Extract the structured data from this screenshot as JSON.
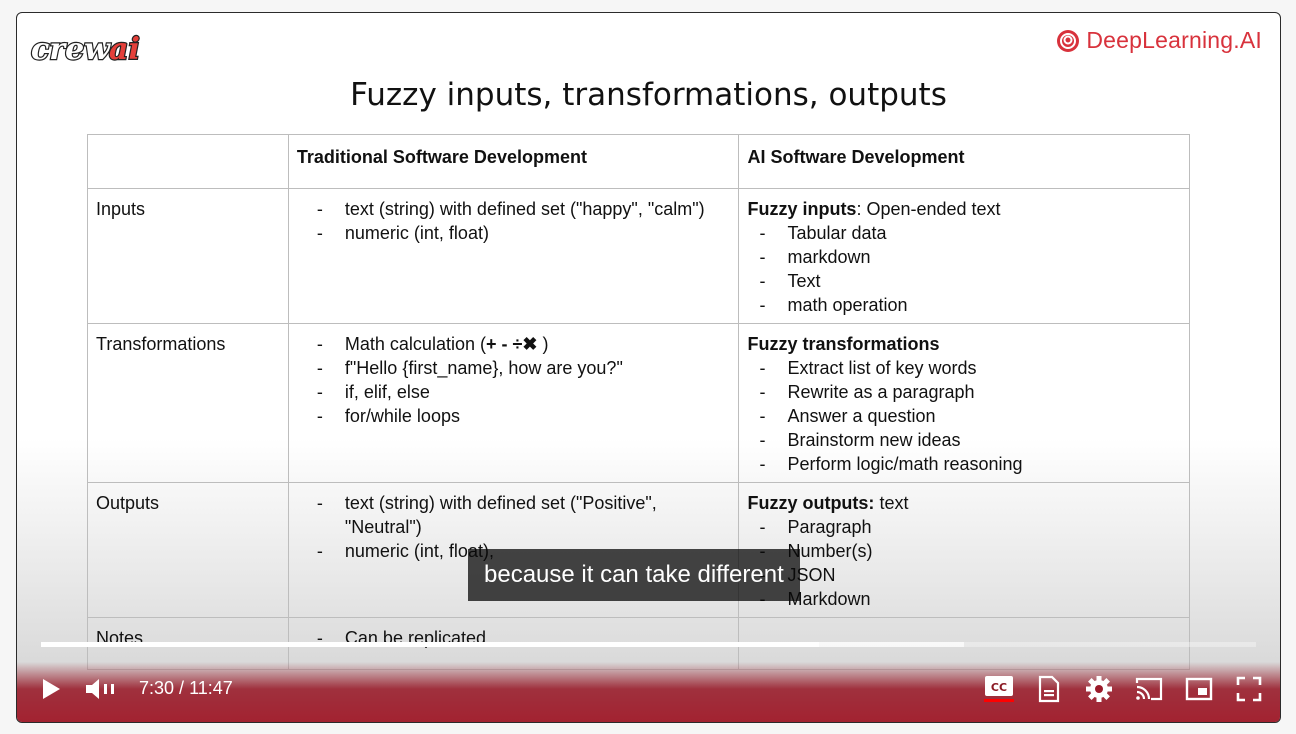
{
  "logos": {
    "left": "crewai",
    "right": "DeepLearning.AI"
  },
  "slide": {
    "title": "Fuzzy inputs, transformations, outputs",
    "headers": [
      "",
      "Traditional Software Development",
      "AI Software Development"
    ],
    "rows": [
      {
        "label": "Inputs",
        "traditional": [
          "text (string) with defined set (\"happy\", \"calm\")",
          "numeric (int, float)"
        ],
        "ai_title": "Fuzzy inputs",
        "ai_title_suffix": ": Open-ended text",
        "ai": [
          "Tabular data",
          "markdown",
          "Text",
          "math operation"
        ]
      },
      {
        "label": "Transformations",
        "traditional_first_prefix": "Math calculation (",
        "traditional_first_symbols": "+ - ÷✖",
        "traditional_first_suffix": " )",
        "traditional": [
          "f\"Hello {first_name}, how are you?\"",
          "if, elif, else",
          "for/while loops"
        ],
        "ai_title": "Fuzzy transformations",
        "ai_title_suffix": "",
        "ai": [
          "Extract list of key words",
          "Rewrite as a paragraph",
          "Answer a question",
          "Brainstorm new ideas",
          "Perform logic/math reasoning"
        ]
      },
      {
        "label": "Outputs",
        "traditional": [
          "text (string) with defined set (\"Positive\", \"Neutral\")",
          "numeric (int, float),"
        ],
        "ai_title": "Fuzzy outputs:",
        "ai_title_suffix": " text",
        "ai": [
          "Paragraph",
          "Number(s)",
          "JSON",
          "Markdown"
        ]
      },
      {
        "label": "Notes",
        "traditional": [
          "Can be replicated"
        ],
        "ai": []
      }
    ]
  },
  "caption": "because it can take different",
  "player": {
    "time_current": "7:30",
    "time_separator": " / ",
    "time_total": "11:47",
    "progress_played": 0.64,
    "progress_loaded": 0.76,
    "icons": {
      "play": "play-icon",
      "volume": "volume-icon",
      "subtitles": "subtitles-icon",
      "transcript": "transcript-icon",
      "settings": "settings-icon",
      "cast": "cast-icon",
      "miniplayer": "miniplayer-icon",
      "fullscreen": "fullscreen-icon"
    }
  },
  "colors": {
    "brand_red": "#d8323c",
    "progress": "#ffffff"
  }
}
